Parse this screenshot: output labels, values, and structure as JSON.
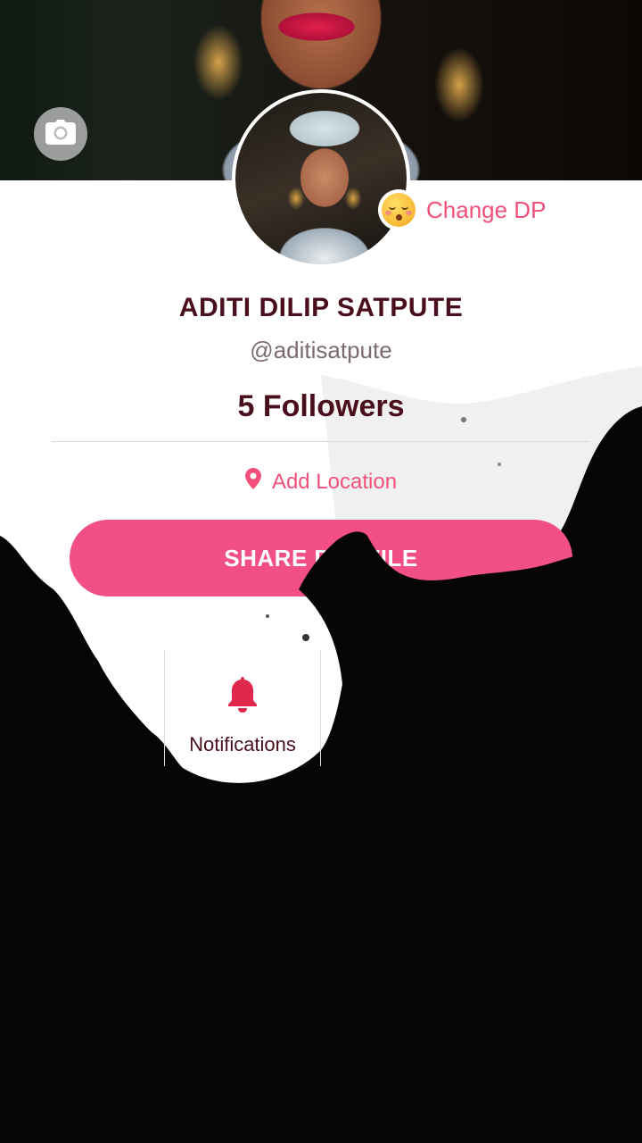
{
  "profile": {
    "name": "ADITI DILIP SATPUTE",
    "handle": "@aditisatpute",
    "followers": "5 Followers",
    "change_dp_label": "Change DP",
    "add_location_label": "Add Location",
    "share_label": "SHARE PROFILE"
  },
  "menu": {
    "notifications_label": "Notifications"
  },
  "colors": {
    "accent": "#f24f85",
    "accent_text": "#f0507a",
    "name_text": "#4a0f1d",
    "handle_text": "#7b6a70"
  },
  "icons": {
    "camera": "camera-icon",
    "location": "location-pin-icon",
    "notifications": "bell-icon",
    "emoji": "kissing-face-icon"
  }
}
